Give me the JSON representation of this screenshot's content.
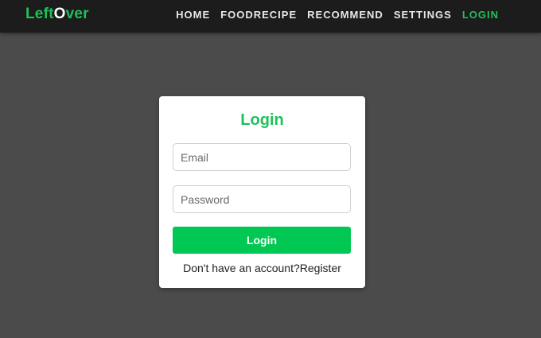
{
  "brand": {
    "prefix": "Left",
    "highlight": "O",
    "suffix": "ver"
  },
  "nav": {
    "items": [
      {
        "label": "HOME",
        "active": false
      },
      {
        "label": "FOODRECIPE",
        "active": false
      },
      {
        "label": "RECOMMEND",
        "active": false
      },
      {
        "label": "SETTINGS",
        "active": false
      },
      {
        "label": "LOGIN",
        "active": true
      }
    ]
  },
  "login": {
    "title": "Login",
    "email_placeholder": "Email",
    "password_placeholder": "Password",
    "submit_label": "Login",
    "prompt_text": "Don't have an account?",
    "register_label": "Register"
  },
  "colors": {
    "accent": "#1fc15a",
    "button": "#00c853",
    "navbar": "#1c1c1c",
    "background": "#4b4b4b"
  }
}
